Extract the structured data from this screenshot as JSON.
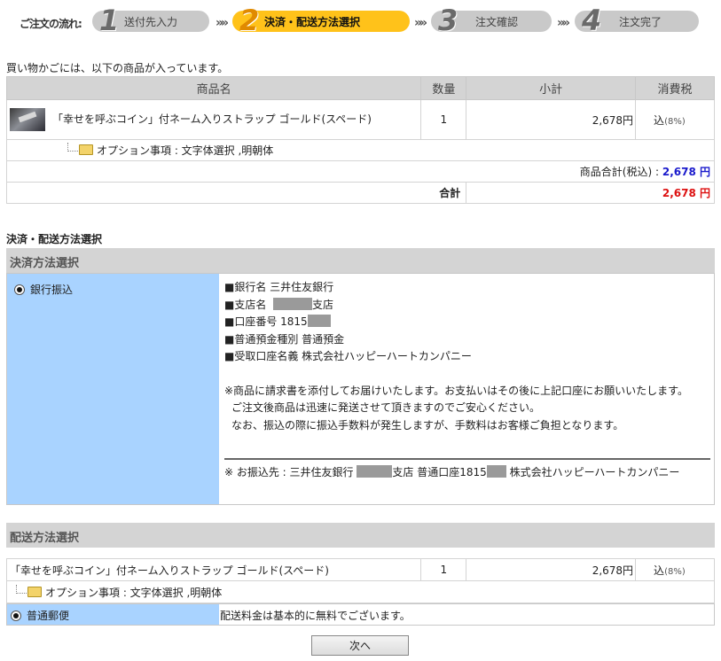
{
  "steps": {
    "flow_label": "ご注文の流れ:",
    "items": [
      {
        "num": "1",
        "label": "送付先入力"
      },
      {
        "num": "2",
        "label": "決済・配送方法選択"
      },
      {
        "num": "3",
        "label": "注文確認"
      },
      {
        "num": "4",
        "label": "注文完了"
      }
    ],
    "arrow": "»»"
  },
  "cart": {
    "intro": "買い物かごには、以下の商品が入っています。",
    "headers": [
      "商品名",
      "数量",
      "小計",
      "消費税"
    ],
    "item": {
      "name": "「幸せを呼ぶコイン」付ネーム入りストラップ ゴールド(スペード)",
      "qty": "1",
      "subtotal": "2,678円",
      "tax_label": "込",
      "tax_rate": "(8%)",
      "option": "オプション事項 : 文字体選択 ,明朝体"
    },
    "goods_total_label": "商品合計(税込) :",
    "goods_total_value": "2,678 円",
    "total_label": "合計",
    "total_value": "2,678 円",
    "colors": {
      "goods_total": "#1a1acc",
      "total": "#dd1111"
    }
  },
  "payment": {
    "section_title": "決済・配送方法選択",
    "header": "決済方法選択",
    "option": "銀行振込",
    "bank_name": "■銀行名  三井住友銀行",
    "branch_prefix": "■支店名",
    "branch_suffix": "支店",
    "account_prefix": "■口座番号  1815",
    "deposit_type": "■普通預金種別  普通預金",
    "holder": "■受取口座名義  株式会社ハッピーハートカンパニー",
    "notice_1": "※商品に請求書を添付してお届けいたします。お支払いはその後に上記口座にお願いいたします。",
    "notice_2": "ご注文後商品は迅速に発送させて頂きますのでご安心ください。",
    "notice_3": "なお、振込の際に振込手数料が発生しますが、手数料はお客様ご負担となります。",
    "transfer_prefix": "※ お振込先 : 三井住友銀行",
    "transfer_mid": "支店 普通口座1815",
    "transfer_suffix": "株式会社ハッピーハートカンパニー"
  },
  "shipping": {
    "header": "配送方法選択",
    "item_name": "「幸せを呼ぶコイン」付ネーム入りストラップ ゴールド(スペード)",
    "qty": "1",
    "subtotal": "2,678円",
    "tax_label": "込",
    "tax_rate": "(8%)",
    "option": "オプション事項 : 文字体選択 ,明朝体",
    "method": "普通郵便",
    "method_note": "配送料金は基本的に無料でございます。"
  },
  "next_button": "次へ"
}
